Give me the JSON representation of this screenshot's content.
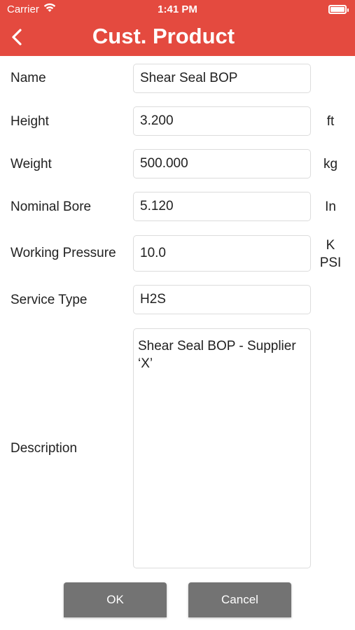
{
  "status_bar": {
    "carrier": "Carrier",
    "time": "1:41 PM",
    "icons": [
      "wifi-icon",
      "battery-icon"
    ]
  },
  "nav": {
    "title": "Cust. Product",
    "back_icon": "chevron-left-icon"
  },
  "form": {
    "name": {
      "label": "Name",
      "value": "Shear Seal BOP"
    },
    "height": {
      "label": "Height",
      "value": "3.200",
      "unit": "ft"
    },
    "weight": {
      "label": "Weight",
      "value": "500.000",
      "unit": "kg"
    },
    "nominal_bore": {
      "label": "Nominal Bore",
      "value": "5.120",
      "unit": "In"
    },
    "working_pressure": {
      "label": "Working Pressure",
      "value": "10.0",
      "unit_line1": "K",
      "unit_line2": "PSI"
    },
    "service_type": {
      "label": "Service Type",
      "value": "H2S"
    },
    "description": {
      "label": "Description",
      "value": "Shear Seal BOP - Supplier ‘X’"
    }
  },
  "buttons": {
    "ok": "OK",
    "cancel": "Cancel"
  },
  "colors": {
    "header": "#e44a3f",
    "button": "#737373"
  }
}
